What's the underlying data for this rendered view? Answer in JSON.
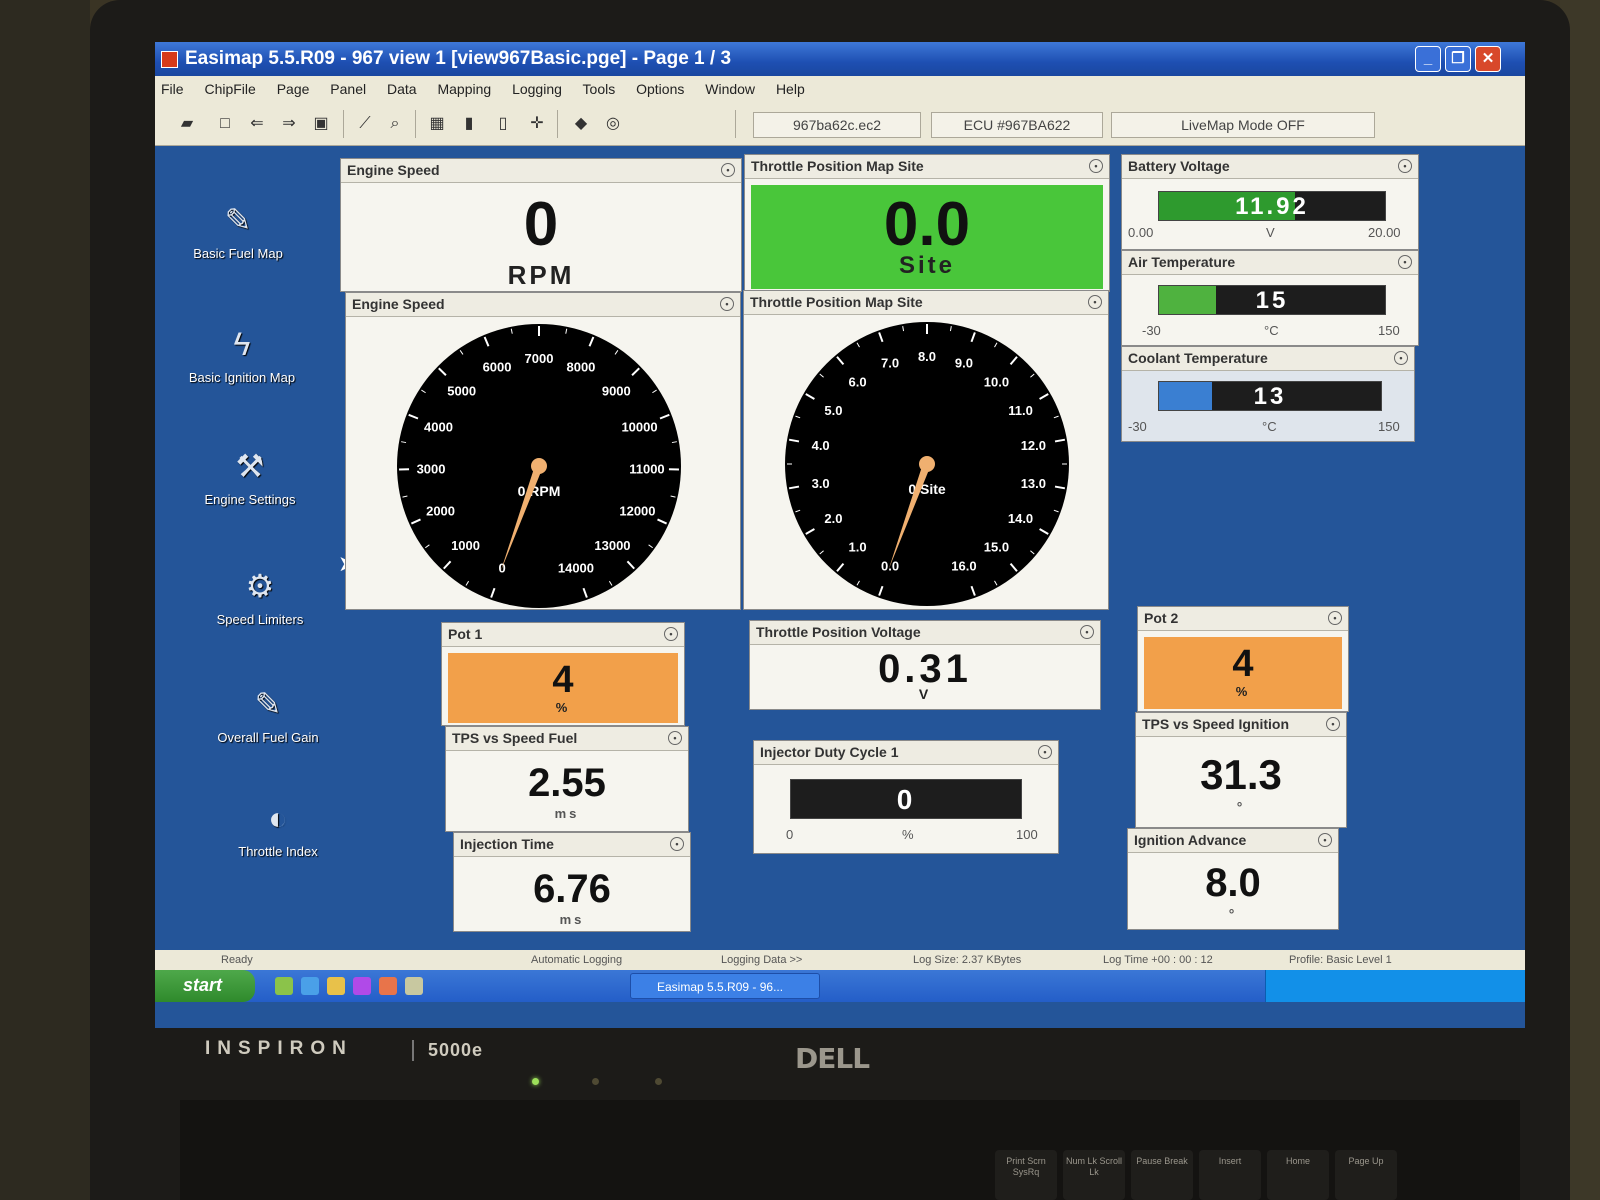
{
  "window": {
    "title": "Easimap 5.5.R09 - 967 view 1 [view967Basic.pge] - Page 1 / 3"
  },
  "menu": [
    "File",
    "ChipFile",
    "Page",
    "Panel",
    "Data",
    "Mapping",
    "Logging",
    "Tools",
    "Options",
    "Window",
    "Help"
  ],
  "toolbar": {
    "file_field": "967ba62c.ec2",
    "ecu_field": "ECU #967BA622",
    "livemap_field": "LiveMap Mode OFF"
  },
  "desktop_icons": [
    {
      "label": "Basic Fuel Map",
      "icon": "fuel-injector-icon"
    },
    {
      "label": "Basic Ignition Map",
      "icon": "spark-plug-icon"
    },
    {
      "label": "Engine Settings",
      "icon": "wrench-icon"
    },
    {
      "label": "Speed Limiters",
      "icon": "tools-icon"
    },
    {
      "label": "Overall Fuel Gain",
      "icon": "fuel-injector-icon"
    },
    {
      "label": "Throttle Index",
      "icon": "throttle-icon"
    }
  ],
  "panels": {
    "engine_speed_digital": {
      "title": "Engine Speed",
      "value": "0",
      "unit": "RPM"
    },
    "throttle_site_digital": {
      "title": "Throttle Position Map Site",
      "value": "0.0",
      "unit": "Site",
      "color": "#49c63a"
    },
    "engine_speed_gauge": {
      "title": "Engine Speed",
      "center_label": "0 RPM",
      "value": 0,
      "ticks": [
        "0",
        "1000",
        "2000",
        "3000",
        "4000",
        "5000",
        "6000",
        "7000",
        "8000",
        "9000",
        "10000",
        "11000",
        "12000",
        "13000",
        "14000"
      ]
    },
    "throttle_site_gauge": {
      "title": "Throttle Position Map Site",
      "center_label": "0 Site",
      "value": 0,
      "ticks": [
        "0.0",
        "1.0",
        "2.0",
        "3.0",
        "4.0",
        "5.0",
        "6.0",
        "7.0",
        "8.0",
        "9.0",
        "10.0",
        "11.0",
        "12.0",
        "13.0",
        "14.0",
        "15.0",
        "16.0"
      ]
    },
    "battery_voltage": {
      "title": "Battery Voltage",
      "value": "11.92",
      "min": "0.00",
      "max": "20.00",
      "unit": "V",
      "fill_fraction": 0.6,
      "color": "#2e9a2e"
    },
    "air_temperature": {
      "title": "Air Temperature",
      "value": "15",
      "min": "-30",
      "max": "150",
      "unit": "°C",
      "fill_fraction": 0.25,
      "color": "#4fb23f"
    },
    "coolant_temperature": {
      "title": "Coolant Temperature",
      "value": "13",
      "min": "-30",
      "max": "150",
      "unit": "°C",
      "fill_fraction": 0.24,
      "color": "#3a7fd2"
    },
    "pot1": {
      "title": "Pot 1",
      "value": "4",
      "unit": "%",
      "color": "#f2a04a"
    },
    "tps_speed_fuel": {
      "title": "TPS vs Speed Fuel",
      "value": "2.55",
      "unit": "ms"
    },
    "injection_time": {
      "title": "Injection Time",
      "value": "6.76",
      "unit": "ms"
    },
    "throttle_voltage": {
      "title": "Throttle Position Voltage",
      "value": "0.31",
      "unit": "V"
    },
    "injector_duty": {
      "title": "Injector Duty Cycle 1",
      "value": "0",
      "min": "0",
      "max": "100",
      "unit": "%",
      "fill_fraction": 0
    },
    "pot2": {
      "title": "Pot 2",
      "value": "4",
      "unit": "%",
      "color": "#f2a04a"
    },
    "tps_speed_ignition": {
      "title": "TPS vs Speed Ignition",
      "value": "31.3",
      "unit": "°"
    },
    "ignition_advance": {
      "title": "Ignition Advance",
      "value": "8.0",
      "unit": "°"
    }
  },
  "statusbar": {
    "ready": "Ready",
    "auto_logging": "Automatic Logging",
    "logging_data": "Logging Data >>",
    "log_size": "Log Size:  2.37 KBytes",
    "log_time": "Log Time  +00 : 00 : 12",
    "profile": "Profile:  Basic Level 1"
  },
  "taskbar": {
    "start": "start",
    "task": "Easimap 5.5.R09 - 96..."
  },
  "laptop": {
    "model": "INSPIRON",
    "model_number": "5000e",
    "brand": "DELL"
  },
  "keys": [
    "Print Scrn SysRq",
    "Num Lk Scroll Lk",
    "Pause Break",
    "Insert",
    "Home",
    "Page Up"
  ]
}
